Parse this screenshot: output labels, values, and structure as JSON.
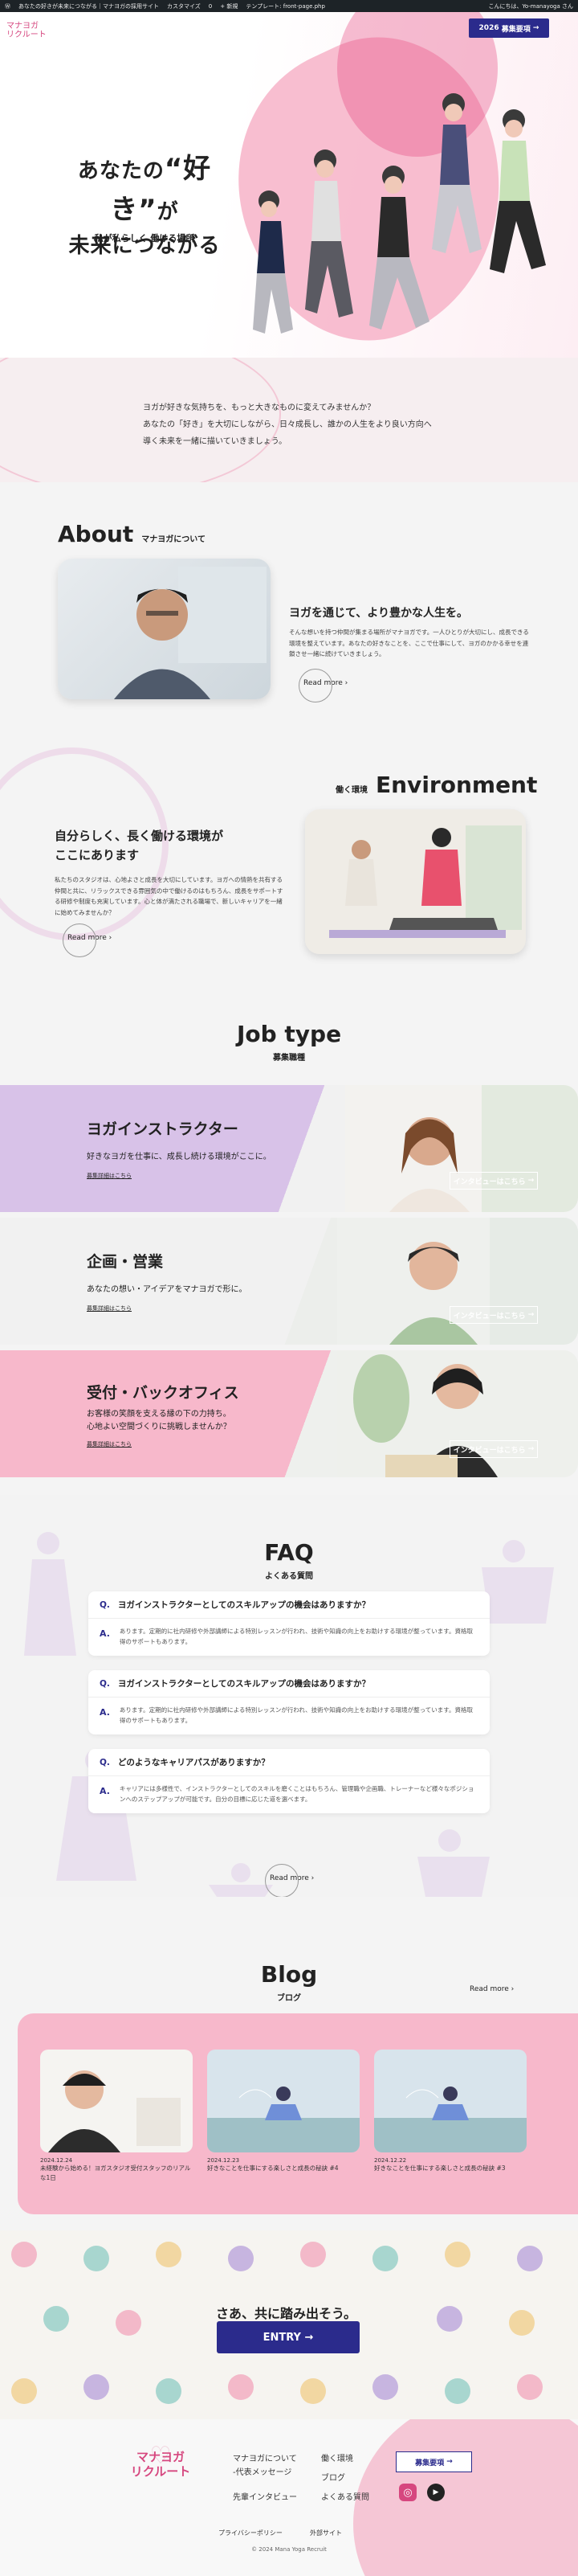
{
  "admin_bar": {
    "site": "あなたの好きが未来につながる｜マナヨガの採用サイト",
    "customize": "カスタマイズ",
    "counts": "0",
    "new": "新規",
    "template": "テンプレート: front-page.php",
    "greeting": "こんにちは、Yo-manayoga さん"
  },
  "header": {
    "logo_line1": "マナヨガ",
    "logo_line2": "リクルート",
    "recruit_year": "2026",
    "recruit_label": "募集要項"
  },
  "hero": {
    "line1_pre": "あなたの",
    "line1_em": "“好き”",
    "line1_post": "が",
    "line2": "未来につながる",
    "sub": "私が私らしく 働ける場所"
  },
  "intro": {
    "l1": "ヨガが好きな気持ちを、もっと大きなものに変えてみませんか？",
    "l2": "あなたの「好き」を大切にしながら、日々成長し、誰かの人生をより良い方向へ",
    "l3": "導く未来を一緒に描いていきましょう。"
  },
  "about": {
    "heading": "About",
    "sub": "マナヨガについて",
    "title": "ヨガを通じて、より豊かな人生を。",
    "body": "そんな想いを持つ仲間が集まる場所がマナヨガです。一人ひとりが大切にし、成長できる環境を整えています。あなたの好きなことを、ここで仕事にして、ヨガのかかる幸せを連鎖させ一緒に続けていきましょう。",
    "readmore": "Read more"
  },
  "environment": {
    "heading": "Environment",
    "sub": "働く環境",
    "title_l1": "自分らしく、長く働ける環境が",
    "title_l2": "ここにあります",
    "body": "私たちのスタジオは、心地よさと成長を大切にしています。ヨガへの情熱を共有する仲間と共に、リラックスできる雰囲気の中で働けるのはもちろん、成長をサポートする研修や制度も充実しています。心と体が満たされる職場で、新しいキャリアを一緒に始めてみませんか？",
    "readmore": "Read more"
  },
  "jobs": {
    "heading": "Job type",
    "sub": "募集職種",
    "items": [
      {
        "title": "ヨガインストラクター",
        "desc1": "好きなヨガを仕事に、成長し続ける環境がここに。",
        "desc2": "",
        "link": "募集詳細はこちら",
        "interview": "インタビューはこちら"
      },
      {
        "title": "企画・営業",
        "desc1": "あなたの想い・アイデアをマナヨガで形に。",
        "desc2": "",
        "link": "募集詳細はこちら",
        "interview": "インタビューはこちら"
      },
      {
        "title": "受付・バックオフィス",
        "desc1": "お客様の笑顔を支える縁の下の力持ち。",
        "desc2": "心地よい空間づくりに挑戦しませんか？",
        "link": "募集詳細はこちら",
        "interview": "インタビューはこちら"
      }
    ]
  },
  "faq": {
    "heading": "FAQ",
    "sub": "よくある質問",
    "items": [
      {
        "q": "ヨガインストラクターとしてのスキルアップの機会はありますか？",
        "a": "あります。定期的に社内研修や外部講師による特別レッスンが行われ、技術や知識の向上をお助けする環境が整っています。資格取得のサポートもあります。"
      },
      {
        "q": "ヨガインストラクターとしてのスキルアップの機会はありますか？",
        "a": "あります。定期的に社内研修や外部講師による特別レッスンが行われ、技術や知識の向上をお助けする環境が整っています。資格取得のサポートもあります。"
      },
      {
        "q": "どのようなキャリアパスがありますか？",
        "a": "キャリアには多様性で、インストラクターとしてのスキルを磨くことはもちろん、管理職や企画職、トレーナーなど様々なポジションへのステップアップが可能です。自分の目標に応じた道を選べます。"
      }
    ],
    "readmore": "Read more"
  },
  "blog": {
    "heading": "Blog",
    "sub": "ブログ",
    "readmore": "Read more",
    "posts": [
      {
        "date": "2024.12.24",
        "title": "未経験から始める！ヨガスタジオ受付スタッフのリアルな1日"
      },
      {
        "date": "2024.12.23",
        "title": "好きなことを仕事にする楽しさと成長の秘訣 #4"
      },
      {
        "date": "2024.12.22",
        "title": "好きなことを仕事にする楽しさと成長の秘訣 #3"
      }
    ]
  },
  "entry": {
    "message": "さあ、共に踏み出そう。",
    "button": "ENTRY"
  },
  "footer": {
    "logo_line1": "マナヨガ",
    "logo_line2": "リクルート",
    "links": [
      "マナヨガについて",
      "-代表メッセージ",
      "先輩インタビュー",
      "働く環境",
      "ブログ",
      "よくある質問"
    ],
    "recruit": "募集要項",
    "privacy": "プライバシーポリシー",
    "external": "外部サイト",
    "copyright": "© 2024 Mana Yoga Recruit"
  },
  "colors": {
    "accent": "#2b2b8c",
    "pink": "#f7b8cb",
    "magenta": "#e6457f",
    "lavender": "#d9c3e6"
  }
}
